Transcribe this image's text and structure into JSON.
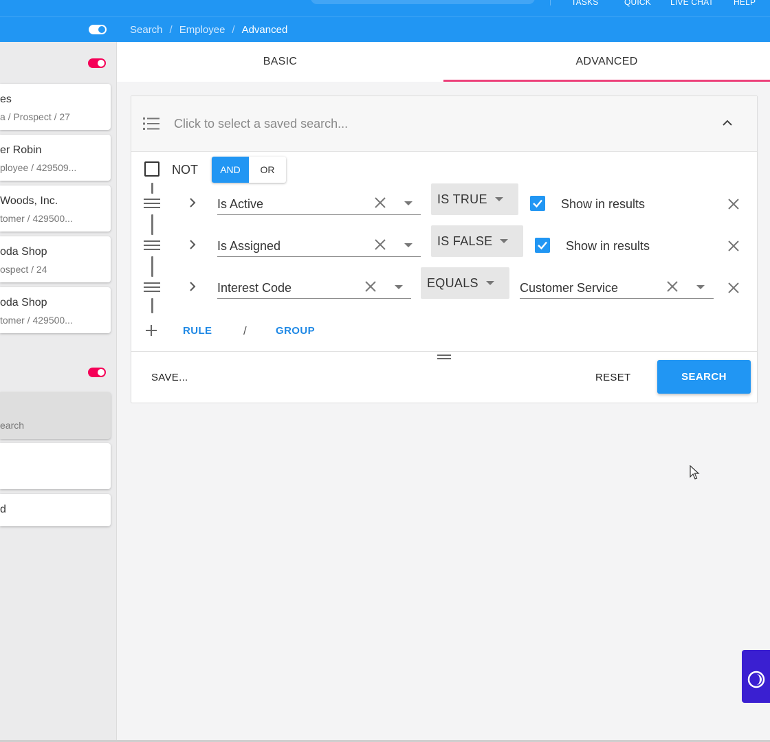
{
  "topnav": {
    "items": [
      "TASKS",
      "QUICK",
      "LIVE CHAT",
      "HELP"
    ]
  },
  "breadcrumb": [
    "Search",
    "Employee",
    "Advanced"
  ],
  "sidebar": {
    "recent_cards": [
      {
        "title": "es",
        "subtitle": "a / Prospect / 27"
      },
      {
        "title": "er Robin",
        "subtitle": "ployee / 429509..."
      },
      {
        "title": "Woods, Inc.",
        "subtitle": "tomer / 429500..."
      },
      {
        "title": "oda Shop",
        "subtitle": "ospect / 24"
      },
      {
        "title": "oda Shop",
        "subtitle": "tomer / 429500..."
      }
    ],
    "saved_cards": [
      {
        "title": "",
        "subtitle": "earch"
      },
      {
        "title": "",
        "subtitle": ""
      },
      {
        "title": "d",
        "subtitle": ""
      }
    ]
  },
  "tabs": [
    "BASIC",
    "ADVANCED"
  ],
  "saved_search": {
    "placeholder": "Click to select a saved search..."
  },
  "group": {
    "not_label": "NOT",
    "and_label": "AND",
    "or_label": "OR"
  },
  "rules": [
    {
      "field": "Is Active",
      "operator": "IS TRUE",
      "show_label": "Show in results"
    },
    {
      "field": "Is Assigned",
      "operator": "IS FALSE",
      "show_label": "Show in results"
    },
    {
      "field": "Interest Code",
      "operator": "EQUALS",
      "value": "Customer Service"
    }
  ],
  "add": {
    "rule_label": "RULE",
    "separator": "/",
    "group_label": "GROUP"
  },
  "actions": {
    "save_label": "SAVE...",
    "reset_label": "RESET",
    "search_label": "SEARCH"
  },
  "colors": {
    "primary": "#2196f3",
    "accent": "#ec407a",
    "toggle": "#f50057",
    "widget": "#3a1fd1"
  }
}
